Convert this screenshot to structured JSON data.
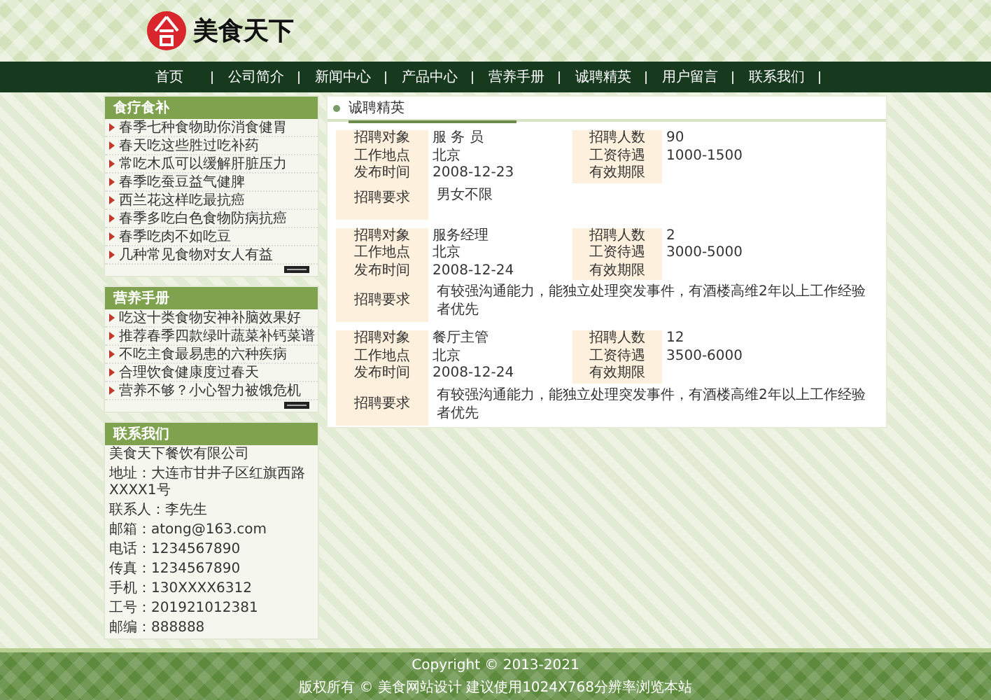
{
  "header": {
    "logo_text": "美食天下"
  },
  "nav": [
    {
      "label": "首页"
    },
    {
      "label": "公司简介"
    },
    {
      "label": "新闻中心"
    },
    {
      "label": "产品中心"
    },
    {
      "label": "营养手册"
    },
    {
      "label": "诚聘精英"
    },
    {
      "label": "用户留言"
    },
    {
      "label": "联系我们"
    }
  ],
  "sidebar": [
    {
      "kind": "list",
      "title": "食疗食补",
      "items": [
        "春季七种食物助你消食健胃",
        "春天吃这些胜过吃补药",
        "常吃木瓜可以缓解肝脏压力",
        "春季吃蚕豆益气健脾",
        "西兰花这样吃最抗癌",
        "春季多吃白色食物防病抗癌",
        "春季吃肉不如吃豆",
        "几种常见食物对女人有益"
      ]
    },
    {
      "kind": "list",
      "title": "营养手册",
      "items": [
        "吃这十类食物安神补脑效果好",
        "推荐春季四款绿叶蔬菜补钙菜谱",
        "不吃主食最易患的六种疾病",
        "合理饮食健康度过春天",
        "营养不够？小心智力被饿危机"
      ]
    },
    {
      "kind": "contact",
      "title": "联系我们",
      "lines": [
        "美食天下餐饮有限公司",
        "地址：大连市甘井子区红旗西路XXXX1号",
        "联系人：李先生",
        "邮箱：atong@163.com",
        "电话：1234567890",
        "传真：1234567890",
        "手机：130XXXX6312",
        "工号：201921012381",
        "邮编：888888"
      ]
    }
  ],
  "main": {
    "title": "诚聘精英",
    "jobs": [
      {
        "rows": [
          [
            {
              "label": "招聘对象",
              "value": "服 务 员"
            },
            {
              "label": "招聘人数",
              "value": "90"
            }
          ],
          [
            {
              "label": "工作地点",
              "value": "北京"
            },
            {
              "label": "工资待遇",
              "value": "1000-1500"
            }
          ],
          [
            {
              "label": "发布时间",
              "value": "2008-12-23"
            },
            {
              "label": "有效期限"
            }
          ]
        ],
        "requirement_label": "招聘要求",
        "requirement": "男女不限"
      },
      {
        "rows": [
          [
            {
              "label": "招聘对象",
              "value": "服务经理"
            },
            {
              "label": "招聘人数",
              "value": "2"
            }
          ],
          [
            {
              "label": "工作地点",
              "value": "北京"
            },
            {
              "label": "工资待遇",
              "value": "3000-5000"
            }
          ],
          [
            {
              "label": "发布时间",
              "value": "2008-12-24"
            },
            {
              "label": "有效期限"
            }
          ]
        ],
        "requirement_label": "招聘要求",
        "requirement": "有较强沟通能力，能独立处理突发事件，有酒楼高维2年以上工作经验者优先"
      },
      {
        "rows": [
          [
            {
              "label": "招聘对象",
              "value": "餐厅主管"
            },
            {
              "label": "招聘人数",
              "value": "12"
            }
          ],
          [
            {
              "label": "工作地点",
              "value": "北京"
            },
            {
              "label": "工资待遇",
              "value": "3500-6000"
            }
          ],
          [
            {
              "label": "发布时间",
              "value": "2008-12-24"
            },
            {
              "label": "有效期限"
            }
          ]
        ],
        "requirement_label": "招聘要求",
        "requirement": "有较强沟通能力，能独立处理突发事件，有酒楼高维2年以上工作经验者优先"
      }
    ]
  },
  "footer": {
    "lines": [
      "Copyright © 2013-2021",
      "版权所有 © 美食网站设计 建议使用1024X768分辨率浏览本站"
    ]
  }
}
